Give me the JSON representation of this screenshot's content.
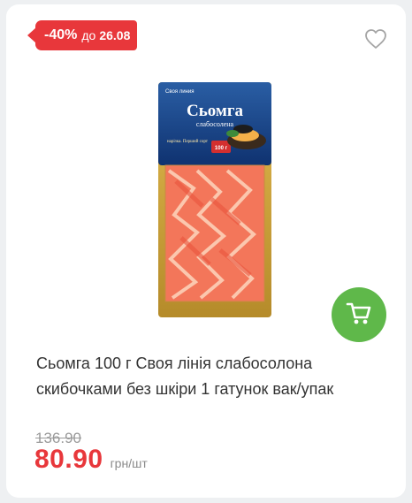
{
  "badge": {
    "discount": "-40%",
    "until": "до",
    "date": "26.08"
  },
  "favorite_icon": "heart-outline-icon",
  "cart_icon": "cart-icon",
  "product": {
    "package_brand": "Своя линия",
    "package_title": "Сьомга",
    "package_subtitle": "слабосолена",
    "package_caption": "нарізка. Перший сорт",
    "package_weight": "100 г",
    "title": "Сьомга 100 г Своя лінія слабосолона скибочками без шкіри 1 гатунок вак/упак"
  },
  "pricing": {
    "old_price": "136.90",
    "price": "80.90",
    "unit": "грн/шт"
  },
  "colors": {
    "accent_red": "#e8373b",
    "cart_green": "#5fb84a"
  }
}
